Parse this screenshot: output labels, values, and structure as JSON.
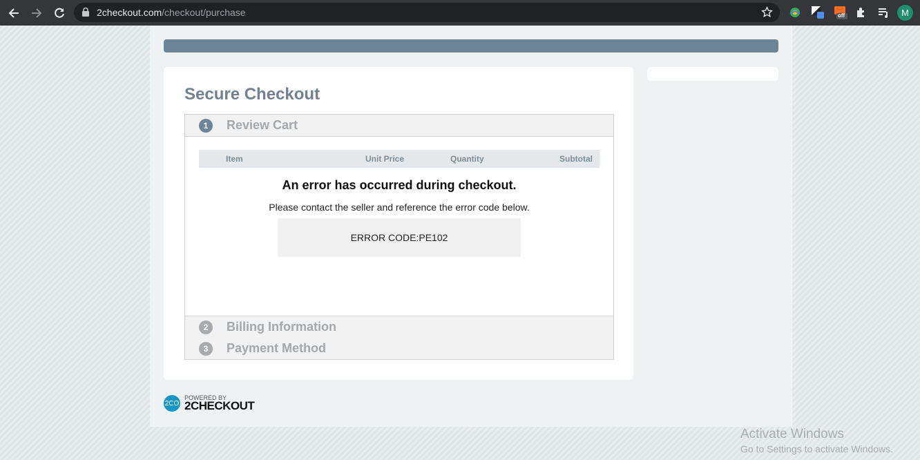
{
  "browser": {
    "url_host": "2checkout.com",
    "url_path": "/checkout/purchase",
    "profile_initial": "M",
    "extension_badge": "off",
    "icons": [
      "back-arrow-icon",
      "forward-arrow-icon",
      "reload-icon",
      "lock-icon",
      "bookmark-star-icon",
      "extension-globe-icon",
      "extension-contrast-icon",
      "extension-coupon-icon",
      "extensions-puzzle-icon",
      "reading-list-icon"
    ]
  },
  "checkout": {
    "title": "Secure Checkout",
    "steps": [
      {
        "number": "1",
        "label": "Review Cart",
        "color": "#6e8497"
      },
      {
        "number": "2",
        "label": "Billing Information",
        "color": "#a7abae"
      },
      {
        "number": "3",
        "label": "Payment Method",
        "color": "#a7abae"
      }
    ],
    "cart_columns": [
      "Item",
      "Unit Price",
      "Quantity",
      "Subtotal"
    ],
    "error": {
      "title": "An error has occurred during checkout.",
      "message": "Please contact the seller and reference the error code below.",
      "code": "ERROR CODE:PE102"
    }
  },
  "footer": {
    "logo_text": "2CO",
    "powered_by": "POWERED BY",
    "brand": "2CHECKOUT"
  },
  "watermark": {
    "title": "Activate Windows",
    "subtitle": "Go to Settings to activate Windows."
  },
  "colors": {
    "accent": "#6e8497",
    "brand_blue": "#1696c4",
    "chrome_bg": "#35363a"
  }
}
